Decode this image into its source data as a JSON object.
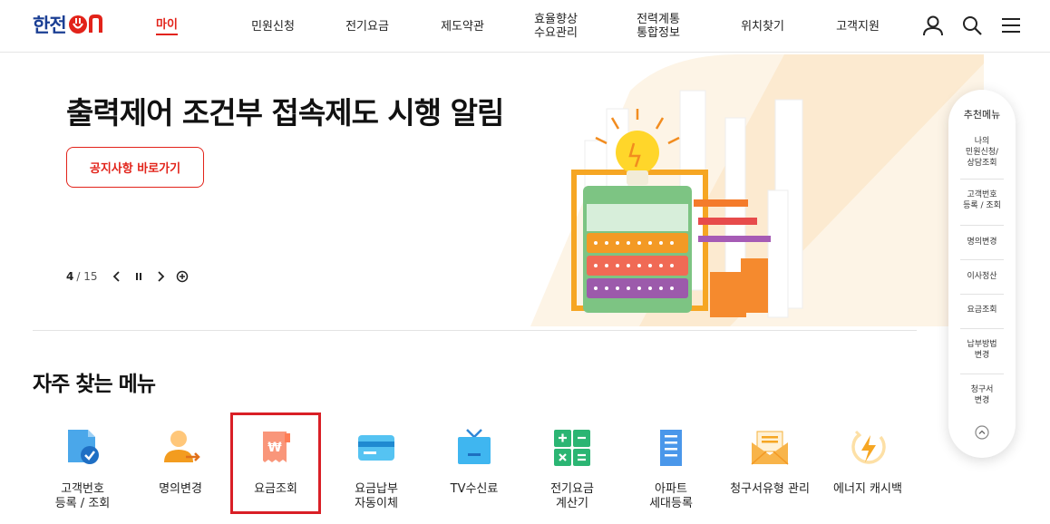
{
  "header": {
    "logo_text": "한전",
    "logo_suffix": "ON",
    "nav": [
      {
        "label": "마이",
        "active": true
      },
      {
        "label": "민원신청"
      },
      {
        "label": "전기요금"
      },
      {
        "label": "제도약관"
      },
      {
        "label": "효율향상\n수요관리"
      },
      {
        "label": "전력계통\n통합정보"
      },
      {
        "label": "위치찾기"
      },
      {
        "label": "고객지원"
      }
    ],
    "icons": [
      "user-icon",
      "search-icon",
      "menu-icon"
    ]
  },
  "hero": {
    "title": "출력제어 조건부 접속제도 시행 알림",
    "button_label": "공지사항 바로가기",
    "pager_current": "4",
    "pager_total": "/ 15"
  },
  "frequent": {
    "title": "자주 찾는 메뉴",
    "items": [
      {
        "label": "고객번호\n등록 / 조회",
        "icon": "customer-number-icon"
      },
      {
        "label": "명의변경",
        "icon": "name-change-icon"
      },
      {
        "label": "요금조회",
        "icon": "bill-inquiry-icon",
        "highlighted": true
      },
      {
        "label": "요금납부\n자동이체",
        "icon": "card-payment-icon"
      },
      {
        "label": "TV수신료",
        "icon": "tv-icon"
      },
      {
        "label": "전기요금\n계산기",
        "icon": "calculator-icon"
      },
      {
        "label": "아파트\n세대등록",
        "icon": "apartment-icon"
      },
      {
        "label": "청구서유형 관리",
        "icon": "envelope-icon"
      },
      {
        "label": "에너지 캐시백",
        "icon": "energy-cashback-icon"
      }
    ]
  },
  "side_menu": {
    "title": "추천메뉴",
    "items": [
      "나의\n민원신청/\n상담조회",
      "고객번호\n등록 / 조회",
      "명의변경",
      "이사정산",
      "요금조회",
      "납부방법\n변경",
      "청구서\n변경"
    ]
  },
  "colors": {
    "brand_blue": "#1b3f94",
    "accent_red": "#e2231a",
    "highlight_box": "#d91f26"
  }
}
